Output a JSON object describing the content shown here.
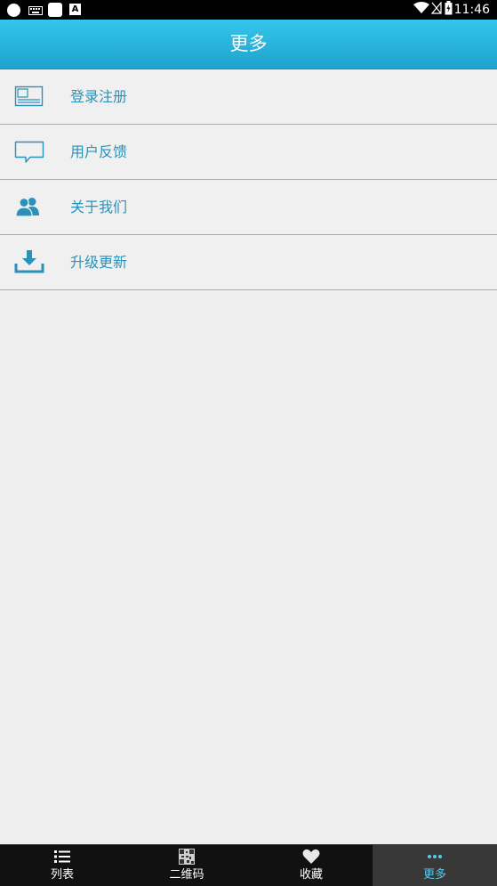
{
  "status_bar": {
    "time": "11:46",
    "icons": [
      "notification-dot-icon",
      "keyboard-icon",
      "app-square-icon",
      "font-a-icon",
      "wifi-icon",
      "no-signal-icon",
      "battery-icon"
    ]
  },
  "header": {
    "title": "更多"
  },
  "menu": {
    "items": [
      {
        "label": "登录注册",
        "icon": "id-card-icon"
      },
      {
        "label": "用户反馈",
        "icon": "chat-bubble-icon"
      },
      {
        "label": "关于我们",
        "icon": "users-icon"
      },
      {
        "label": "升级更新",
        "icon": "download-icon"
      }
    ]
  },
  "tab_bar": {
    "tabs": [
      {
        "label": "列表",
        "icon": "list-icon"
      },
      {
        "label": "二维码",
        "icon": "qr-code-icon"
      },
      {
        "label": "收藏",
        "icon": "heart-icon"
      },
      {
        "label": "更多",
        "icon": "more-dots-icon"
      }
    ],
    "active": "更多"
  },
  "colors": {
    "header_top": "#35c6ec",
    "header_bottom": "#1da3cd",
    "menu_text": "#2a91ba",
    "background": "#efefef",
    "tab_bar": "#111111",
    "active_tab_text": "#5ac8ec"
  }
}
